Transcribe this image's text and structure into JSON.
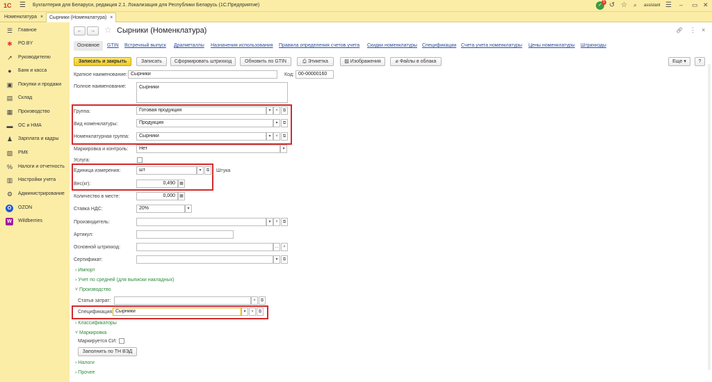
{
  "titlebar": {
    "logo": "1С",
    "title": "Бухгалтерия для Беларуси, редакция 2.1. Локализация для Республики Беларусь (1С:Предприятие)",
    "notification_count": "1",
    "user": "assistant"
  },
  "open_tabs": [
    {
      "label": "Номенклатура"
    },
    {
      "label": "Сырники (Номенклатура)"
    }
  ],
  "sidebar": {
    "items": [
      {
        "label": "Главное",
        "icon": "☰"
      },
      {
        "label": "РО.BY",
        "icon": "✱"
      },
      {
        "label": "Руководителю",
        "icon": "↗"
      },
      {
        "label": "Банк и касса",
        "icon": "●"
      },
      {
        "label": "Покупки и продажи",
        "icon": "▣"
      },
      {
        "label": "Склад",
        "icon": "▤"
      },
      {
        "label": "Производство",
        "icon": "▦"
      },
      {
        "label": "ОС и НМА",
        "icon": "▬"
      },
      {
        "label": "Зарплата и кадры",
        "icon": "♟"
      },
      {
        "label": "РМК",
        "icon": "▧"
      },
      {
        "label": "Налоги и отчетность",
        "icon": "%"
      },
      {
        "label": "Настройки учета",
        "icon": "▥"
      },
      {
        "label": "Администрирование",
        "icon": "⚙"
      },
      {
        "label": "OZON",
        "icon": "O"
      },
      {
        "label": "Wildberries",
        "icon": "W"
      }
    ]
  },
  "form": {
    "title": "Сырники (Номенклатура)",
    "nav_links": [
      "Основное",
      "GTIN",
      "Встречный выпуск",
      "Драгметаллы",
      "Назначения использования",
      "Правила определения счетов учета",
      "Скидки номенклатуры",
      "Спецификации",
      "Счета учета номенклатуры",
      "Цены номенклатуры",
      "Штрихкоды"
    ],
    "buttons": {
      "save_close": "Записать и закрыть",
      "save": "Записать",
      "gen_barcode": "Сформировать штрихкод",
      "update_gtin": "Обновить по GTIN",
      "label": "Этикетка",
      "images": "Изображения",
      "cloud_files": "Файлы в облака",
      "more": "Еще",
      "help": "?"
    },
    "fields": {
      "short_name": {
        "label": "Краткое наименование:",
        "value": "Сырники"
      },
      "code": {
        "label": "Код:",
        "value": "00-00000160"
      },
      "full_name": {
        "label": "Полное наименование:",
        "value": "Сырники"
      },
      "group": {
        "label": "Группа:",
        "value": "Готовая продукция"
      },
      "kind": {
        "label": "Вид номенклатуры:",
        "value": "Продукция"
      },
      "nom_group": {
        "label": "Номенклатурная группа:",
        "value": "Сырники"
      },
      "marking": {
        "label": "Маркировка и контроль:",
        "value": "Нет"
      },
      "service": {
        "label": "Услуга:"
      },
      "unit": {
        "label": "Единица измерения:",
        "value": "шт",
        "caption": "Штука"
      },
      "weight": {
        "label": "Вес(кг):",
        "value": "0,490"
      },
      "qty_place": {
        "label": "Количество в месте:",
        "value": "0,000"
      },
      "vat": {
        "label": "Ставка НДС:",
        "value": "20%"
      },
      "manufacturer": {
        "label": "Производитель:",
        "value": ""
      },
      "article": {
        "label": "Артикул:",
        "value": ""
      },
      "barcode": {
        "label": "Основной штрихкод:",
        "value": ""
      },
      "certificate": {
        "label": "Сертификат:",
        "value": ""
      }
    },
    "groups": {
      "import": "Импорт",
      "avg": "Учет по средней (для выписки накладных)",
      "production": "Производство",
      "cost_item": {
        "label": "Статья затрат:",
        "value": ""
      },
      "spec": {
        "label": "Спецификация:",
        "value": "Сырники"
      },
      "classifiers": "Классификаторы",
      "marking": "Маркировка",
      "marked_si": {
        "label": "Маркируется СИ:"
      },
      "fill_tn": "Заполнить по ТН ВЭД",
      "taxes": "Налоги",
      "other": "Прочее"
    }
  }
}
